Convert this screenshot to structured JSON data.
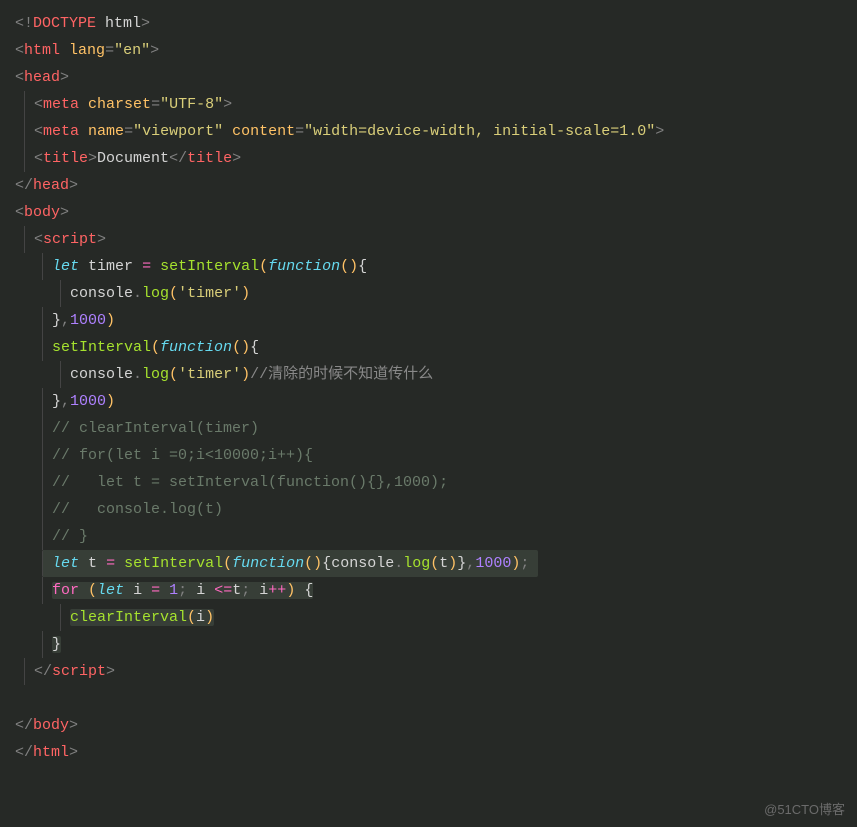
{
  "watermark": "@51CTO博客",
  "code": {
    "doctype": {
      "bang": "<!",
      "word": "DOCTYPE",
      "rest": " html",
      "close": ">"
    },
    "html_open": {
      "tag": "html",
      "attr": "lang",
      "val": "\"en\""
    },
    "head_open": "head",
    "meta1": {
      "tag": "meta",
      "a1": "charset",
      "v1": "\"UTF-8\""
    },
    "meta2": {
      "tag": "meta",
      "a1": "name",
      "v1": "\"viewport\"",
      "a2": "content",
      "v2": "\"width=device-width, initial-scale=1.0\""
    },
    "title": {
      "tag": "title",
      "text": "Document"
    },
    "head_close": "head",
    "body_open": "body",
    "script_open": "script",
    "l1": {
      "let": "let",
      "var": "timer",
      "eq": "=",
      "fn": "setInterval",
      "kw": "function"
    },
    "l2": {
      "obj": "console",
      "method": "log",
      "str": "'timer'"
    },
    "l3": {
      "num": "1000"
    },
    "l4": {
      "fn": "setInterval",
      "kw": "function"
    },
    "l5": {
      "obj": "console",
      "method": "log",
      "str": "'timer'",
      "cm": "//清除的时候不知道传什么"
    },
    "l6": {
      "num": "1000"
    },
    "c1": "// clearInterval(timer)",
    "c2": "// for(let i =0;i<10000;i++){",
    "c3": "//   let t = setInterval(function(){},1000);",
    "c4": "//   console.log(t)",
    "c5": "// }",
    "l7": {
      "let": "let",
      "var": "t",
      "eq": "=",
      "fn": "setInterval",
      "kw": "function",
      "obj": "console",
      "method": "log",
      "arg": "t",
      "num": "1000"
    },
    "l8": {
      "for": "for",
      "let": "let",
      "i": "i",
      "one": "1",
      "t": "t"
    },
    "l9": {
      "fn": "clearInterval",
      "arg": "i"
    },
    "script_close": "script",
    "body_close": "body",
    "html_close": "html"
  }
}
